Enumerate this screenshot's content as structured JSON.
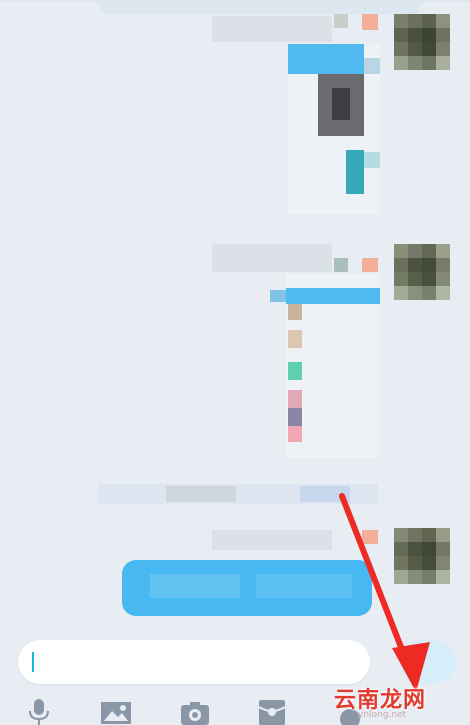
{
  "input": {
    "value": "",
    "placeholder": ""
  },
  "watermark": {
    "main": "云南龙网",
    "sub": "ynlong.net"
  },
  "colors": {
    "background": "#e8edf4",
    "bubble_blue": "#48b8f2",
    "caret": "#1cb4d6",
    "annotation_arrow": "#ee2a24"
  },
  "toolbar": {
    "icons": [
      "microphone-icon",
      "image-icon",
      "camera-icon",
      "gift-icon",
      "plus-icon"
    ]
  }
}
